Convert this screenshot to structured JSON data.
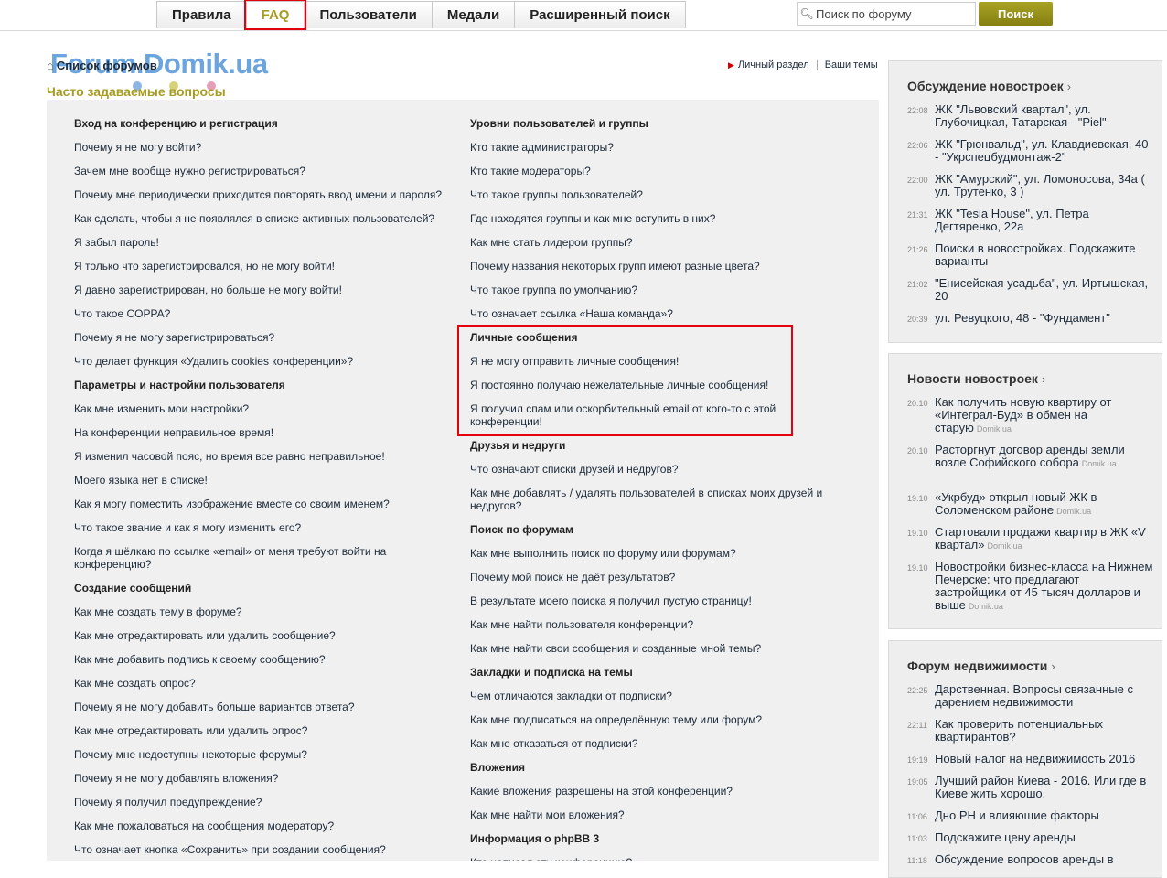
{
  "nav": {
    "tabs": [
      "Правила",
      "FAQ",
      "Пользователи",
      "Медали",
      "Расширенный поиск"
    ],
    "active": "FAQ",
    "search_placeholder": "Поиск по форуму",
    "search_button": "Поиск"
  },
  "logo": "Forum.Domik.ua",
  "breadcrumb": "Список форумов",
  "page_title": "Часто задаваемые вопросы",
  "top_links": [
    "Личный раздел",
    "Ваши темы"
  ],
  "faq_left": [
    {
      "text": "Вход на конференцию и регистрация",
      "heading": true
    },
    {
      "text": "Почему я не могу войти?"
    },
    {
      "text": "Зачем мне вообще нужно регистрироваться?"
    },
    {
      "text": "Почему мне периодически приходится повторять ввод имени и пароля?"
    },
    {
      "text": "Как сделать, чтобы я не появлялся в списке активных пользователей?"
    },
    {
      "text": "Я забыл пароль!"
    },
    {
      "text": "Я только что зарегистрировался, но не могу войти!"
    },
    {
      "text": "Я давно зарегистрирован, но больше не могу войти!"
    },
    {
      "text": "Что такое COPPA?"
    },
    {
      "text": "Почему я не могу зарегистрироваться?"
    },
    {
      "text": "Что делает функция «Удалить cookies конференции»?"
    },
    {
      "text": "Параметры и настройки пользователя",
      "heading": true
    },
    {
      "text": "Как мне изменить мои настройки?"
    },
    {
      "text": "На конференции неправильное время!"
    },
    {
      "text": "Я изменил часовой пояс, но время все равно неправильное!"
    },
    {
      "text": "Моего языка нет в списке!"
    },
    {
      "text": "Как я могу поместить изображение вместе со своим именем?"
    },
    {
      "text": "Что такое звание и как я могу изменить его?"
    },
    {
      "text": "Когда я щёлкаю по ссылке «email» от меня требуют войти на конференцию?"
    },
    {
      "text": "Создание сообщений",
      "heading": true
    },
    {
      "text": "Как мне создать тему в форуме?"
    },
    {
      "text": "Как мне отредактировать или удалить сообщение?"
    },
    {
      "text": "Как мне добавить подпись к своему сообщению?"
    },
    {
      "text": "Как мне создать опрос?"
    },
    {
      "text": "Почему я не могу добавить больше вариантов ответа?"
    },
    {
      "text": "Как мне отредактировать или удалить опрос?"
    },
    {
      "text": "Почему мне недоступны некоторые форумы?"
    },
    {
      "text": "Почему я не могу добавлять вложения?"
    },
    {
      "text": "Почему я получил предупреждение?"
    },
    {
      "text": "Как мне пожаловаться на сообщения модератору?"
    },
    {
      "text": "Что означает кнопка «Сохранить» при создании сообщения?"
    }
  ],
  "faq_right": [
    {
      "text": "Уровни пользователей и группы",
      "heading": true
    },
    {
      "text": "Кто такие администраторы?"
    },
    {
      "text": "Кто такие модераторы?"
    },
    {
      "text": "Что такое группы пользователей?"
    },
    {
      "text": "Где находятся группы и как мне вступить в них?"
    },
    {
      "text": "Как мне стать лидером группы?"
    },
    {
      "text": "Почему названия некоторых групп имеют разные цвета?"
    },
    {
      "text": "Что такое группа по умолчанию?"
    },
    {
      "text": "Что означает ссылка «Наша команда»?"
    },
    {
      "text": "Личные сообщения",
      "heading": true
    },
    {
      "text": "Я не могу отправить личные сообщения!"
    },
    {
      "text": "Я постоянно получаю нежелательные личные сообщения!"
    },
    {
      "text": "Я получил спам или оскорбительный email от кого-то с этой конференции!"
    },
    {
      "text": "Друзья и недруги",
      "heading": true
    },
    {
      "text": "Что означают списки друзей и недругов?"
    },
    {
      "text": "Как мне добавлять / удалять пользователей в списках моих друзей и недругов?"
    },
    {
      "text": "Поиск по форумам",
      "heading": true
    },
    {
      "text": "Как мне выполнить поиск по форуму или форумам?"
    },
    {
      "text": "Почему мой поиск не даёт результатов?"
    },
    {
      "text": "В результате моего поиска я получил пустую страницу!"
    },
    {
      "text": "Как мне найти пользователя конференции?"
    },
    {
      "text": "Как мне найти свои сообщения и созданные мной темы?"
    },
    {
      "text": "Закладки и подписка на темы",
      "heading": true
    },
    {
      "text": "Чем отличаются закладки от подписки?"
    },
    {
      "text": "Как мне подписаться на определённую тему или форум?"
    },
    {
      "text": "Как мне отказаться от подписки?"
    },
    {
      "text": "Вложения",
      "heading": true
    },
    {
      "text": "Какие вложения разрешены на этой конференции?"
    },
    {
      "text": "Как мне найти мои вложения?"
    },
    {
      "text": "Информация о phpBB 3",
      "heading": true
    },
    {
      "text": "Кто написал эту конференцию?"
    }
  ],
  "sidebar": [
    {
      "title": "Обсуждение новостроек",
      "items": [
        {
          "time": "22:08",
          "text": "ЖК \"Львовский квартал\", ул. Глубочицкая, Татарская - \"Piel\""
        },
        {
          "time": "22:06",
          "text": "ЖК \"Грюнвальд\", ул. Клавдиевская, 40 - \"Укрспецбудмонтаж-2\""
        },
        {
          "time": "22:00",
          "text": "ЖК \"Амурский\", ул. Ломоносова, 34а ( ул. Трутенко, 3 )"
        },
        {
          "time": "21:31",
          "text": "ЖК \"Tesla House\", ул. Петра Дегтяренко, 22а"
        },
        {
          "time": "21:26",
          "text": "Поиски в новостройках. Подскажите варианты"
        },
        {
          "time": "21:02",
          "text": "\"Енисейская усадьба\", ул. Иртышская, 20"
        },
        {
          "time": "20:39",
          "text": "ул. Ревуцкого, 48 - \"Фундамент\""
        }
      ]
    },
    {
      "title": "Новости новостроек",
      "items": [
        {
          "time": "20.10",
          "text": "Как получить новую квартиру от «Интеграл-Буд» в обмен на старую",
          "source": "Domik.ua"
        },
        {
          "time": "20.10",
          "text": "Расторгнут договор аренды земли возле Софийского собора",
          "source": "Domik.ua"
        },
        {
          "time": "19.10",
          "text": "«Укрбуд» открыл новый ЖК в Соломенском районе",
          "source": "Domik.ua"
        },
        {
          "time": "19.10",
          "text": "Стартовали продажи квартир в ЖК «V квартал»",
          "source": "Domik.ua"
        },
        {
          "time": "19.10",
          "text": "Новостройки бизнес-класса на Нижнем Печерске: что предлагают застройщики от 45 тысяч долларов и выше",
          "source": "Domik.ua"
        }
      ]
    },
    {
      "title": "Форум недвижимости",
      "items": [
        {
          "time": "22:25",
          "text": "Дарственная. Вопросы связанные с дарением недвижимости"
        },
        {
          "time": "22:11",
          "text": "Как проверить потенциальных квартирантов?"
        },
        {
          "time": "19:19",
          "text": "Новый налог на недвижимость 2016"
        },
        {
          "time": "19:05",
          "text": "Лучший район Киева - 2016. Или где в Киеве жить хорошо."
        },
        {
          "time": "11:06",
          "text": "Дно РН и влияющие факторы"
        },
        {
          "time": "11:03",
          "text": "Подскажите цену аренды"
        },
        {
          "time": "11:18",
          "text": "Обсуждение вопросов аренды в"
        }
      ]
    }
  ],
  "colors": {
    "accent": "#a89b22",
    "highlight": "#e3000f",
    "link": "#1d2b3a",
    "logo": "#3a87d6"
  }
}
